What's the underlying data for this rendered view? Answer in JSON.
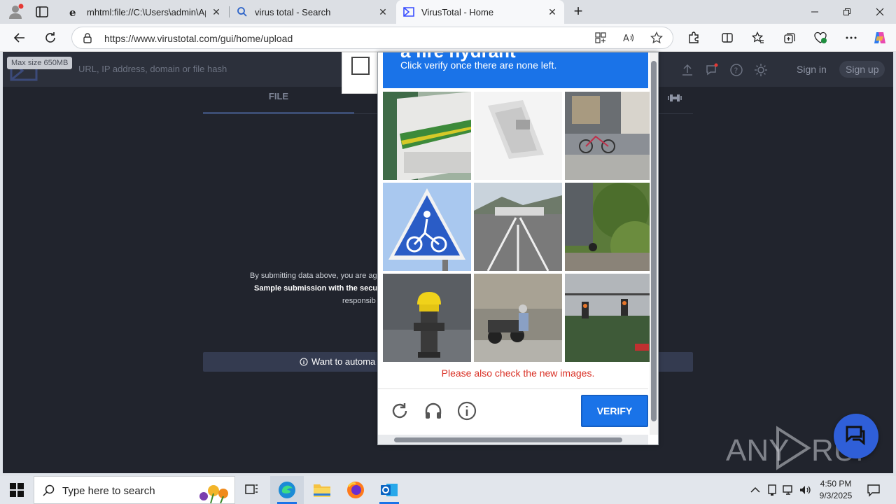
{
  "browser": {
    "tabs": [
      {
        "label": "mhtml:file://C:\\Users\\admin\\AppData",
        "icon": "ie-mode-icon",
        "active": false
      },
      {
        "label": "virus total - Search",
        "icon": "search-icon",
        "active": false
      },
      {
        "label": "VirusTotal - Home",
        "icon": "virustotal-icon",
        "active": true
      }
    ],
    "url": "https://www.virustotal.com/gui/home/upload"
  },
  "virustotal": {
    "search_placeholder": "URL, IP address, domain or file hash",
    "max_size_tooltip": "Max size 650MB",
    "sign_in": "Sign in",
    "sign_up": "Sign up",
    "tab_file": "FILE",
    "terms_line1": "By submitting data above, you are ag",
    "terms_line2": "Sample submission with the secu",
    "terms_line3": "responsib",
    "automate_text": "Want to automa"
  },
  "captcha": {
    "header_big": "a fire hydrant",
    "instruction": "Click verify once there are none left.",
    "tiles": [
      {
        "scene": "truck trailer"
      },
      {
        "scene": "blurry sign"
      },
      {
        "scene": "bicycles at storefront"
      },
      {
        "scene": "bicycle crossing sign"
      },
      {
        "scene": "highway toll"
      },
      {
        "scene": "suv and bushes"
      },
      {
        "scene": "yellow fire hydrant"
      },
      {
        "scene": "motorcycles parked"
      },
      {
        "scene": "traffic lights"
      }
    ],
    "error_message": "Please also check the new images.",
    "verify_label": "VERIFY",
    "colors": {
      "accent": "#1a73e8",
      "error": "#d93025"
    }
  },
  "watermark": "ANY RUN",
  "taskbar": {
    "search_placeholder": "Type here to search",
    "time": "4:50 PM",
    "date": "9/3/2025"
  }
}
